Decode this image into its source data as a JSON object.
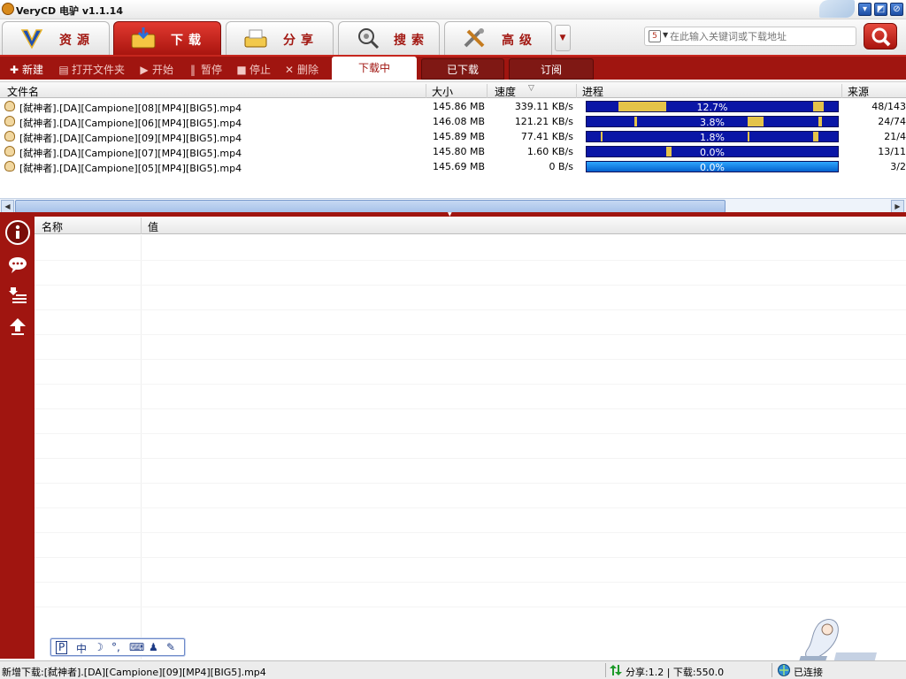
{
  "app": {
    "title": "VeryCD 电驴 v1.1.14"
  },
  "nav": {
    "tabs": [
      {
        "label": "资源",
        "icon": "verycd-v-icon"
      },
      {
        "label": "下载",
        "icon": "download-folder-icon"
      },
      {
        "label": "分享",
        "icon": "share-tray-icon"
      },
      {
        "label": "搜索",
        "icon": "magnifier-search-icon"
      },
      {
        "label": "高级",
        "icon": "tools-icon"
      }
    ],
    "active_tab": "下载"
  },
  "search": {
    "placeholder": "在此输入关键词或下载地址"
  },
  "toolbar": {
    "new": "新建",
    "open_folder": "打开文件夹",
    "start": "开始",
    "pause": "暂停",
    "stop": "停止",
    "delete": "删除"
  },
  "subtabs": {
    "downloading": "下载中",
    "downloaded": "已下载",
    "subscribe": "订阅",
    "active": "下载中"
  },
  "download_table": {
    "columns": {
      "name": "文件名",
      "size": "大小",
      "speed": "速度",
      "progress": "进程",
      "source": "来源"
    },
    "sort_indicator": "▽",
    "rows": [
      {
        "name": "[弑神者].[DA][Campione][08][MP4][BIG5].mp4",
        "size": "145.86 MB",
        "speed": "339.11 KB/s",
        "progress_text": "12.7%",
        "progress": 0.127,
        "source": "48/143"
      },
      {
        "name": "[弑神者].[DA][Campione][06][MP4][BIG5].mp4",
        "size": "146.08 MB",
        "speed": "121.21 KB/s",
        "progress_text": "3.8%",
        "progress": 0.038,
        "source": "24/74"
      },
      {
        "name": "[弑神者].[DA][Campione][09][MP4][BIG5].mp4",
        "size": "145.89 MB",
        "speed": "77.41 KB/s",
        "progress_text": "1.8%",
        "progress": 0.018,
        "source": "21/4"
      },
      {
        "name": "[弑神者].[DA][Campione][07][MP4][BIG5].mp4",
        "size": "145.80 MB",
        "speed": "1.60 KB/s",
        "progress_text": "0.0%",
        "progress": 0.0,
        "source": "13/11"
      },
      {
        "name": "[弑神者].[DA][Campione][05][MP4][BIG5].mp4",
        "size": "145.69 MB",
        "speed": "0 B/s",
        "progress_text": "0.0%",
        "progress": 0.0,
        "source": "3/2"
      }
    ]
  },
  "detail_panel": {
    "columns": {
      "name": "名称",
      "value": "值"
    },
    "side_icons": [
      "info-icon",
      "comment-icon",
      "download-list-icon",
      "upload-icon"
    ]
  },
  "ime": {
    "items": [
      "P",
      "中",
      "☽",
      "°,",
      "⌨",
      "♟",
      "✎"
    ]
  },
  "status": {
    "left": "新增下载:[弑神者].[DA][Campione][09][MP4][BIG5].mp4",
    "share": "分享:1.2 | 下载:550.0",
    "connection": "已连接"
  },
  "colors": {
    "accent": "#a01510",
    "progress_fill": "#0a16a6",
    "progress_chunks": "#e4c34a"
  }
}
